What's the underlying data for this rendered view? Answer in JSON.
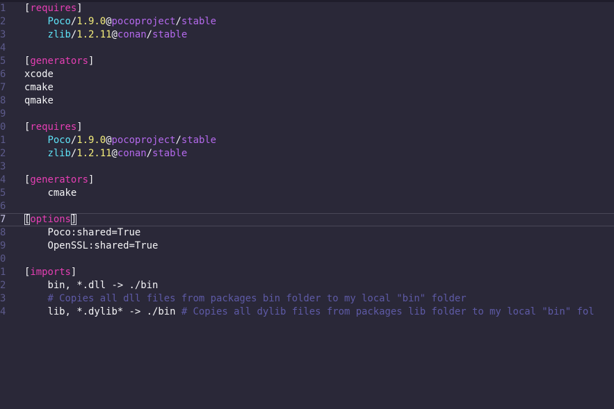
{
  "editor": {
    "lines": [
      {
        "num": "1",
        "segments": [
          {
            "t": "[",
            "c": "br"
          },
          {
            "t": "requires",
            "c": "sec"
          },
          {
            "t": "]",
            "c": "br"
          }
        ]
      },
      {
        "num": "2",
        "segments": [
          {
            "t": "    ",
            "c": "plain"
          },
          {
            "t": "Poco",
            "c": "pkg"
          },
          {
            "t": "/",
            "c": "slash"
          },
          {
            "t": "1.9.0",
            "c": "ver"
          },
          {
            "t": "@",
            "c": "at"
          },
          {
            "t": "pocoproject",
            "c": "user"
          },
          {
            "t": "/",
            "c": "slash"
          },
          {
            "t": "stable",
            "c": "chan"
          }
        ]
      },
      {
        "num": "3",
        "segments": [
          {
            "t": "    ",
            "c": "plain"
          },
          {
            "t": "zlib",
            "c": "pkg"
          },
          {
            "t": "/",
            "c": "slash"
          },
          {
            "t": "1.2.11",
            "c": "ver"
          },
          {
            "t": "@",
            "c": "at"
          },
          {
            "t": "conan",
            "c": "user"
          },
          {
            "t": "/",
            "c": "slash"
          },
          {
            "t": "stable",
            "c": "chan"
          }
        ]
      },
      {
        "num": "4",
        "segments": []
      },
      {
        "num": "5",
        "segments": [
          {
            "t": "[",
            "c": "br"
          },
          {
            "t": "generators",
            "c": "sec"
          },
          {
            "t": "]",
            "c": "br"
          }
        ]
      },
      {
        "num": "6",
        "segments": [
          {
            "t": "xcode",
            "c": "plain"
          }
        ]
      },
      {
        "num": "7",
        "segments": [
          {
            "t": "cmake",
            "c": "plain"
          }
        ]
      },
      {
        "num": "8",
        "segments": [
          {
            "t": "qmake",
            "c": "plain"
          }
        ]
      },
      {
        "num": "9",
        "segments": []
      },
      {
        "num": "0",
        "segments": [
          {
            "t": "[",
            "c": "br"
          },
          {
            "t": "requires",
            "c": "sec"
          },
          {
            "t": "]",
            "c": "br"
          }
        ]
      },
      {
        "num": "1",
        "segments": [
          {
            "t": "    ",
            "c": "plain"
          },
          {
            "t": "Poco",
            "c": "pkg"
          },
          {
            "t": "/",
            "c": "slash"
          },
          {
            "t": "1.9.0",
            "c": "ver"
          },
          {
            "t": "@",
            "c": "at"
          },
          {
            "t": "pocoproject",
            "c": "user"
          },
          {
            "t": "/",
            "c": "slash"
          },
          {
            "t": "stable",
            "c": "chan"
          }
        ]
      },
      {
        "num": "2",
        "segments": [
          {
            "t": "    ",
            "c": "plain"
          },
          {
            "t": "zlib",
            "c": "pkg"
          },
          {
            "t": "/",
            "c": "slash"
          },
          {
            "t": "1.2.11",
            "c": "ver"
          },
          {
            "t": "@",
            "c": "at"
          },
          {
            "t": "conan",
            "c": "user"
          },
          {
            "t": "/",
            "c": "slash"
          },
          {
            "t": "stable",
            "c": "chan"
          }
        ]
      },
      {
        "num": "3",
        "segments": []
      },
      {
        "num": "4",
        "segments": [
          {
            "t": "[",
            "c": "br"
          },
          {
            "t": "generators",
            "c": "sec"
          },
          {
            "t": "]",
            "c": "br"
          }
        ]
      },
      {
        "num": "5",
        "segments": [
          {
            "t": "    ",
            "c": "plain"
          },
          {
            "t": "cmake",
            "c": "plain"
          }
        ]
      },
      {
        "num": "6",
        "segments": []
      },
      {
        "num": "7",
        "current": true,
        "segments": [
          {
            "t": "[",
            "c": "br cursor-box"
          },
          {
            "t": "options",
            "c": "sec"
          },
          {
            "t": "]",
            "c": "br cursor-box"
          }
        ]
      },
      {
        "num": "8",
        "segments": [
          {
            "t": "    ",
            "c": "plain"
          },
          {
            "t": "Poco:shared=True",
            "c": "plain"
          }
        ]
      },
      {
        "num": "9",
        "segments": [
          {
            "t": "    ",
            "c": "plain"
          },
          {
            "t": "OpenSSL:shared=True",
            "c": "plain"
          }
        ]
      },
      {
        "num": "0",
        "segments": []
      },
      {
        "num": "1",
        "segments": [
          {
            "t": "[",
            "c": "br"
          },
          {
            "t": "imports",
            "c": "sec"
          },
          {
            "t": "]",
            "c": "br"
          }
        ]
      },
      {
        "num": "2",
        "segments": [
          {
            "t": "    ",
            "c": "plain"
          },
          {
            "t": "bin, *.dll -> ./bin",
            "c": "plain"
          }
        ]
      },
      {
        "num": "3",
        "segments": [
          {
            "t": "    ",
            "c": "plain"
          },
          {
            "t": "# Copies all dll files from packages bin folder to my local \"bin\" folder",
            "c": "cmt"
          }
        ]
      },
      {
        "num": "4",
        "segments": [
          {
            "t": "    ",
            "c": "plain"
          },
          {
            "t": "lib, *.dylib* -> ./bin ",
            "c": "plain"
          },
          {
            "t": "# Copies all dylib files from packages lib folder to my local \"bin\" fol",
            "c": "cmt"
          }
        ]
      }
    ]
  }
}
